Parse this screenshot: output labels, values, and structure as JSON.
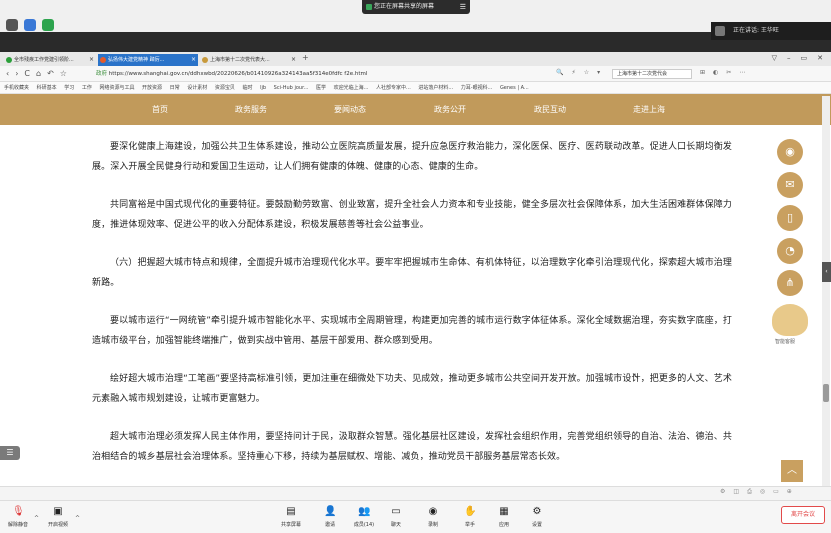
{
  "meeting": {
    "share_status": "您正在屏幕共享的屏幕",
    "share_option": "☰",
    "speaker": "正在讲话: 王华旺"
  },
  "browser": {
    "tabs": [
      {
        "label": "全市残疾工作党建引领阶..."
      },
      {
        "label": "弘扬伟大建党精神 踔厉..."
      },
      {
        "label": "上海市第十二次党代表大..."
      }
    ],
    "new_tab": "+",
    "window_controls": [
      "▽",
      "–",
      "▭",
      "✕"
    ],
    "nav": [
      "‹",
      "›",
      "C",
      "⌂",
      "↶",
      "☆"
    ],
    "url_security": "政府",
    "url": "https://www.shanghai.gov.cn/ddhxwbd/20220626/b01410926a324143aa5f314e0fdfc f2e.html",
    "search_value": "上海市第十二次党代会",
    "tool_icons": [
      "🔍",
      "⚡",
      "☆",
      "▾"
    ],
    "tool_icons2": [
      "⊞",
      "◐",
      "✂",
      "⋯"
    ],
    "bookmarks": [
      "手机收藏夹",
      "科研基本",
      "学习",
      "工作",
      "网络资源与工具",
      "开放资源",
      "日常",
      "设计素材",
      "资源宝贝",
      "临时",
      "ljb",
      "Sci-Hub jour...",
      "医学",
      "欢迎光临上海...",
      "人社部专家中...",
      "进站落户材料...",
      "力耳-眼视科...",
      "Genes | A..."
    ]
  },
  "site_nav": [
    "首页",
    "政务服务",
    "要闻动态",
    "政务公开",
    "政民互动",
    "走进上海"
  ],
  "article": {
    "paragraphs": [
      "要深化健康上海建设，加强公共卫生体系建设，推动公立医院高质量发展，提升应急医疗救治能力，深化医保、医疗、医药联动改革。促进人口长期均衡发展。深入开展全民健身行动和爱国卫生运动，让人们拥有健康的体魄、健康的心态、健康的生命。",
      "共同富裕是中国式现代化的重要特征。要鼓励勤劳致富、创业致富，提升全社会人力资本和专业技能，健全多层次社会保障体系，加大生活困难群体保障力度，推进体现效率、促进公平的收入分配体系建设，积极发展慈善等社会公益事业。",
      "（六）把握超大城市特点和规律，全面提升城市治理现代化水平。要牢牢把握城市生命体、有机体特征，以治理数字化牵引治理现代化，探索超大城市治理新路。",
      "要以城市运行“一网统管”牵引提升城市智能化水平、实现城市全周期管理，构建更加完善的城市运行数字体征体系。深化全域数据治理，夯实数字底座，打造城市级平台，加强智能终端推广，做到实战中管用、基层干部爱用、群众感到受用。",
      "绘好超大城市治理“工笔画”要坚持高标准引领，更加注重在细微处下功夫、见成效，推动更多城市公共空间开发开放。加强城市设计，把更多的人文、艺术元素融入城市规划建设，让城市更富魅力。",
      "超大城市治理必须发挥人民主体作用，要坚持问计于民，汲取群众智慧。强化基层社区建设，发挥社会组织作用，完善党组织领导的自治、法治、德治、共治相结合的城乡基层社会治理体系。坚持重心下移，持续为基层赋权、增能、减负，推动党员干部服务基层常态长效。"
    ]
  },
  "side_icons": [
    "wechat-icon",
    "mail-icon",
    "mobile-icon",
    "rss-icon",
    "share-icon"
  ],
  "mascot_label": "智能客服",
  "meeting_toolbar": {
    "buttons": [
      {
        "label": "解除静音"
      },
      {
        "label": "开启视频"
      },
      {
        "label": "共享屏幕"
      },
      {
        "label": "邀请"
      },
      {
        "label": "成员(14)"
      },
      {
        "label": "聊天"
      },
      {
        "label": "录制"
      },
      {
        "label": "举手"
      },
      {
        "label": "应用"
      },
      {
        "label": "设置"
      }
    ],
    "leave": "离开会议"
  }
}
